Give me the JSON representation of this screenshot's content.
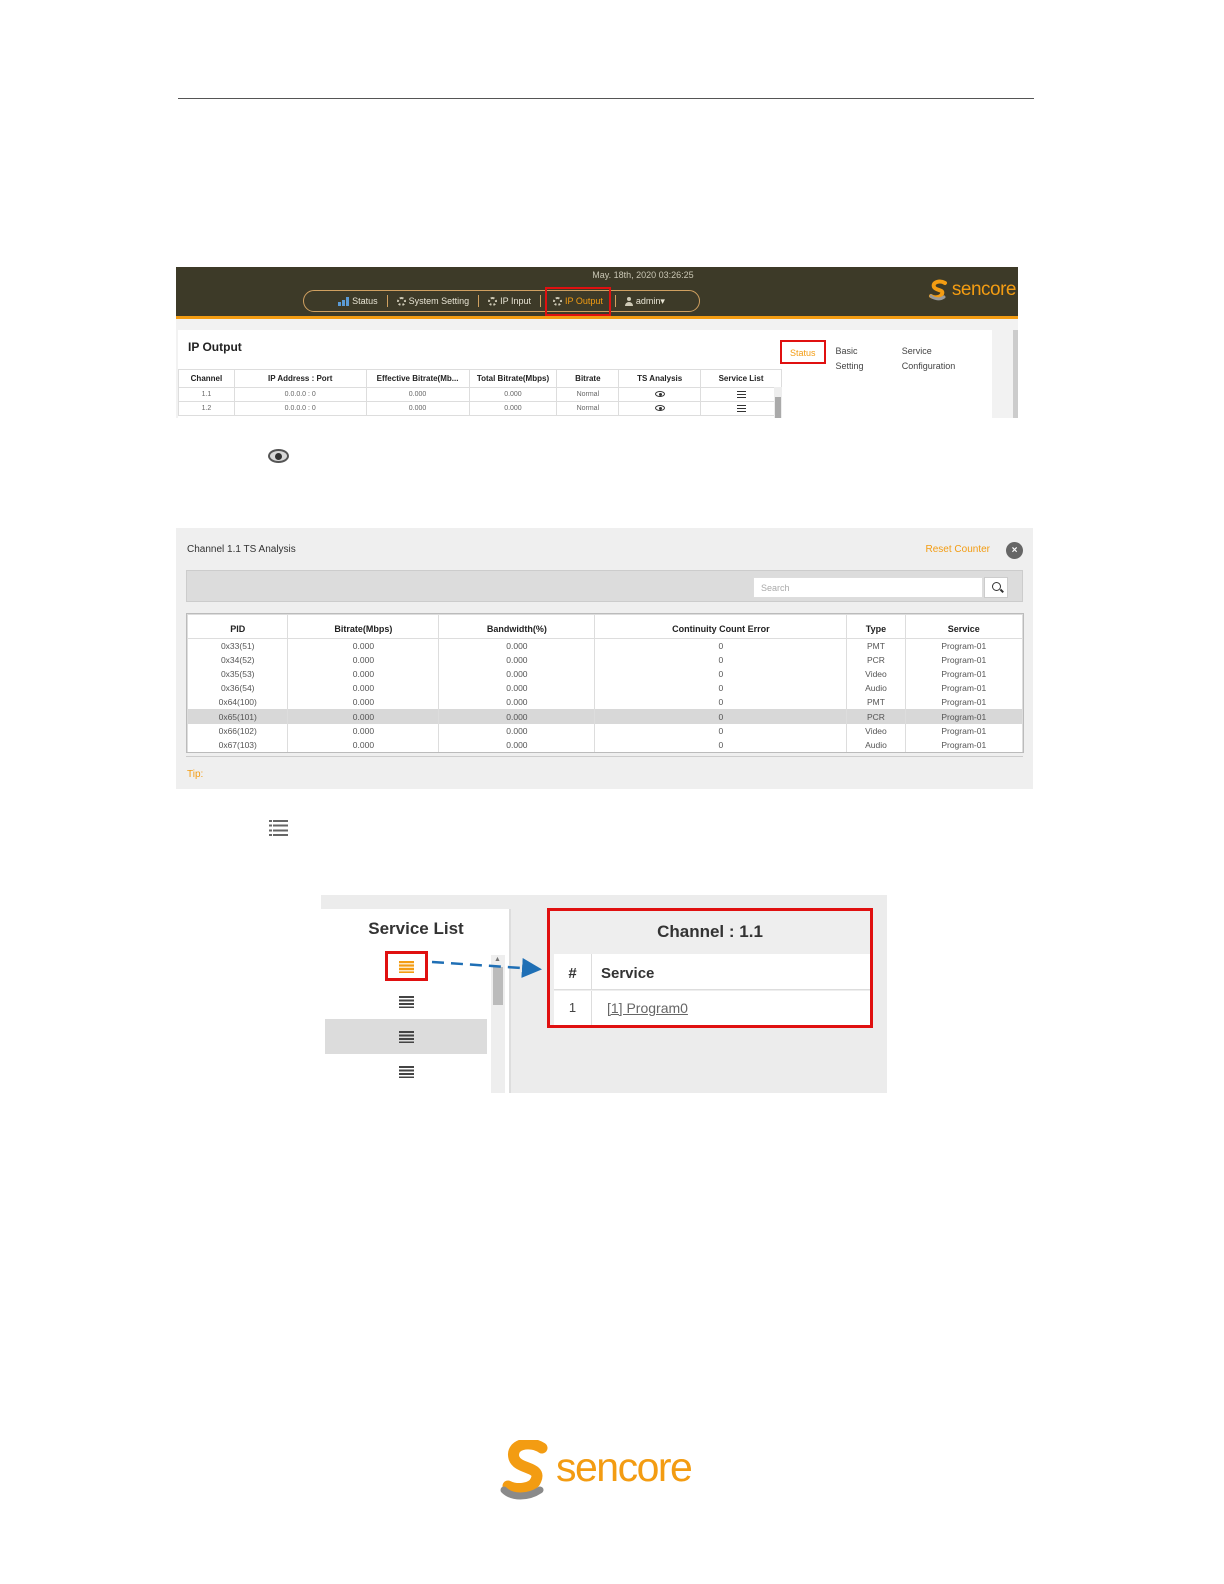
{
  "ip_output": {
    "date": "May. 18th, 2020 03:26:25",
    "nav": [
      {
        "label": "Status",
        "icon": "bar-chart-icon"
      },
      {
        "label": "System Setting",
        "icon": "gear-icon"
      },
      {
        "label": "IP Input",
        "icon": "gear-icon"
      },
      {
        "label": "IP Output",
        "icon": "gear-icon"
      },
      {
        "label": "admin▾",
        "icon": "user-icon"
      }
    ],
    "logo_text": "sencore",
    "title": "IP Output",
    "tabs": [
      "Status",
      "Basic Setting",
      "Service Configuration"
    ],
    "columns": [
      "Channel",
      "IP Address : Port",
      "Effective Bitrate(Mb...",
      "Total Bitrate(Mbps)",
      "Bitrate",
      "TS Analysis",
      "Service List"
    ],
    "rows": [
      {
        "channel": "1.1",
        "ip": "0.0.0.0 : 0",
        "effective": "0.000",
        "total": "0.000",
        "bitrate": "Normal"
      },
      {
        "channel": "1.2",
        "ip": "0.0.0.0 : 0",
        "effective": "0.000",
        "total": "0.000",
        "bitrate": "Normal"
      }
    ]
  },
  "ts_analysis": {
    "title": "Channel 1.1 TS Analysis",
    "reset": "Reset Counter",
    "close": "×",
    "search_placeholder": "Search",
    "columns": [
      "PID",
      "Bitrate(Mbps)",
      "Bandwidth(%)",
      "Continuity Count Error",
      "Type",
      "Service"
    ],
    "rows": [
      [
        "0x33(51)",
        "0.000",
        "0.000",
        "0",
        "PMT",
        "Program-01"
      ],
      [
        "0x34(52)",
        "0.000",
        "0.000",
        "0",
        "PCR",
        "Program-01"
      ],
      [
        "0x35(53)",
        "0.000",
        "0.000",
        "0",
        "Video",
        "Program-01"
      ],
      [
        "0x36(54)",
        "0.000",
        "0.000",
        "0",
        "Audio",
        "Program-01"
      ],
      [
        "0x64(100)",
        "0.000",
        "0.000",
        "0",
        "PMT",
        "Program-01"
      ],
      [
        "0x65(101)",
        "0.000",
        "0.000",
        "0",
        "PCR",
        "Program-01"
      ],
      [
        "0x66(102)",
        "0.000",
        "0.000",
        "0",
        "Video",
        "Program-01"
      ],
      [
        "0x67(103)",
        "0.000",
        "0.000",
        "0",
        "Audio",
        "Program-01"
      ]
    ],
    "tip": "Tip:"
  },
  "service_list": {
    "left_title": "Service List",
    "right_title": "Channel : 1.1",
    "hash_header": "#",
    "service_header": "Service",
    "row_num": "1",
    "row_link": "[1] Program0"
  },
  "footer": {
    "logo_text": "sencore"
  },
  "colors": {
    "accent": "#f39c12",
    "highlight": "#e01010",
    "header_bg": "#3d3a28",
    "arrow": "#1f6fb5"
  }
}
